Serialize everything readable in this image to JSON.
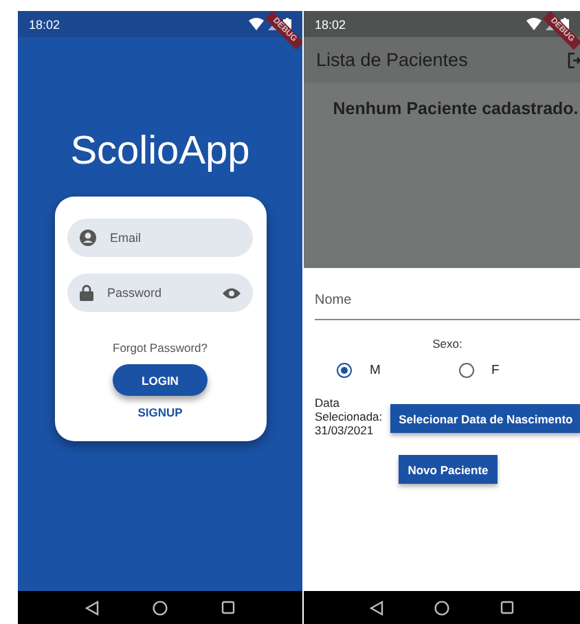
{
  "login_screen": {
    "status_bar": {
      "time": "18:02"
    },
    "debug_banner": "DEBUG",
    "app_title": "ScolioApp",
    "login_card": {
      "fields": [
        {
          "kind": "email",
          "placeholder": "Email"
        },
        {
          "kind": "password",
          "placeholder": "Password"
        }
      ],
      "forgot_link": "Forgot Password?",
      "login_button": "LOGIN",
      "signup_link": "SIGNUP"
    }
  },
  "patients_screen": {
    "status_bar": {
      "time": "18:02"
    },
    "debug_banner": "DEBUG",
    "app_bar": {
      "title": "Lista de Pacientes"
    },
    "empty_message": "Nenhum Paciente cadastrado.",
    "form": {
      "name_field": {
        "placeholder": "Nome"
      },
      "sex_label": "Sexo:",
      "sex_options": [
        {
          "label": "M",
          "selected": true
        },
        {
          "label": "F",
          "selected": false
        }
      ],
      "date_label": "Data Selecionada: 31/03/2021",
      "date_button": "Selecionar Data de Nascimento",
      "submit_button": "Novo Paciente"
    }
  }
}
